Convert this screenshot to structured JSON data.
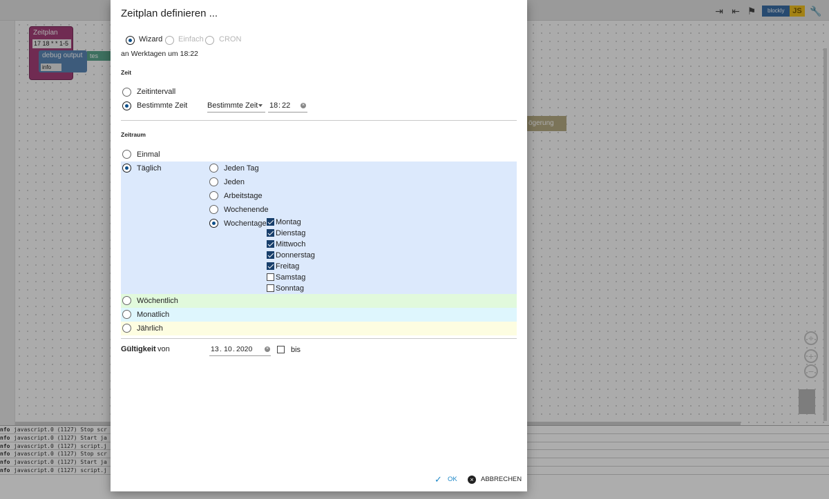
{
  "toolbar": {
    "icons": [
      "export-icon",
      "import-icon",
      "flags-icon",
      "wrench-icon"
    ],
    "blockly_label": "blockly",
    "js_label": "JS"
  },
  "workspace": {
    "blocks": {
      "zeitplan_title": "Zeitplan",
      "zeitplan_cron": "17 18 * * 1-5",
      "debug_label": "debug output",
      "debug_level": "info",
      "text_label": "tes",
      "delay_label": "ögerung"
    }
  },
  "console": {
    "lines": [
      {
        "level": "nfo",
        "text": "javascript.0 (1127) Stop scr"
      },
      {
        "level": "nfo",
        "text": "javascript.0 (1127) Start ja"
      },
      {
        "level": "nfo",
        "text": "javascript.0 (1127) script.j"
      },
      {
        "level": "nfo",
        "text": "javascript.0 (1127) Stop scr"
      },
      {
        "level": "nfo",
        "text": "javascript.0 (1127) Start ja"
      },
      {
        "level": "nfo",
        "text": "javascript.0 (1127) script.j"
      }
    ]
  },
  "dialog": {
    "title": "Zeitplan definieren ...",
    "mode": {
      "options": [
        "Wizard",
        "Einfach",
        "CRON"
      ],
      "selected": "Wizard"
    },
    "summary": "an Werktagen um 18:22",
    "zeit": {
      "heading": "Zeit",
      "options": [
        "Zeitintervall",
        "Bestimmte Zeit"
      ],
      "selected": "Bestimmte Zeit",
      "select_value": "Bestimmte Zeit",
      "hour": "18",
      "minute": "22",
      "sep": ":"
    },
    "zeitraum": {
      "heading": "Zeitraum",
      "options": [
        "Einmal",
        "Täglich",
        "Wöchentlich",
        "Monatlich",
        "Jährlich"
      ],
      "selected": "Täglich",
      "taeglich_options": [
        "Jeden Tag",
        "Jeden",
        "Arbeitstage",
        "Wochenende",
        "Wochentage"
      ],
      "taeglich_selected": "Wochentage",
      "weekdays": [
        {
          "label": "Montag",
          "checked": true
        },
        {
          "label": "Dienstag",
          "checked": true
        },
        {
          "label": "Mittwoch",
          "checked": true
        },
        {
          "label": "Donnerstag",
          "checked": true
        },
        {
          "label": "Freitag",
          "checked": true
        },
        {
          "label": "Samstag",
          "checked": false
        },
        {
          "label": "Sonntag",
          "checked": false
        }
      ]
    },
    "gueltigkeit": {
      "heading": "Gültigkeit",
      "von_label": "von",
      "day": "13",
      "month": "10",
      "year": "2020",
      "sep": ".",
      "bis_label": "bis",
      "bis_checked": false
    },
    "buttons": {
      "ok": "OK",
      "cancel": "ABBRECHEN"
    },
    "colors": {
      "taeglich_band": "#dce9fc",
      "woechentlich_band": "#e1f9dc",
      "monatlich_band": "#def6fd",
      "jaehrlich_band": "#fdfde1",
      "accent": "#1e88c8"
    }
  }
}
